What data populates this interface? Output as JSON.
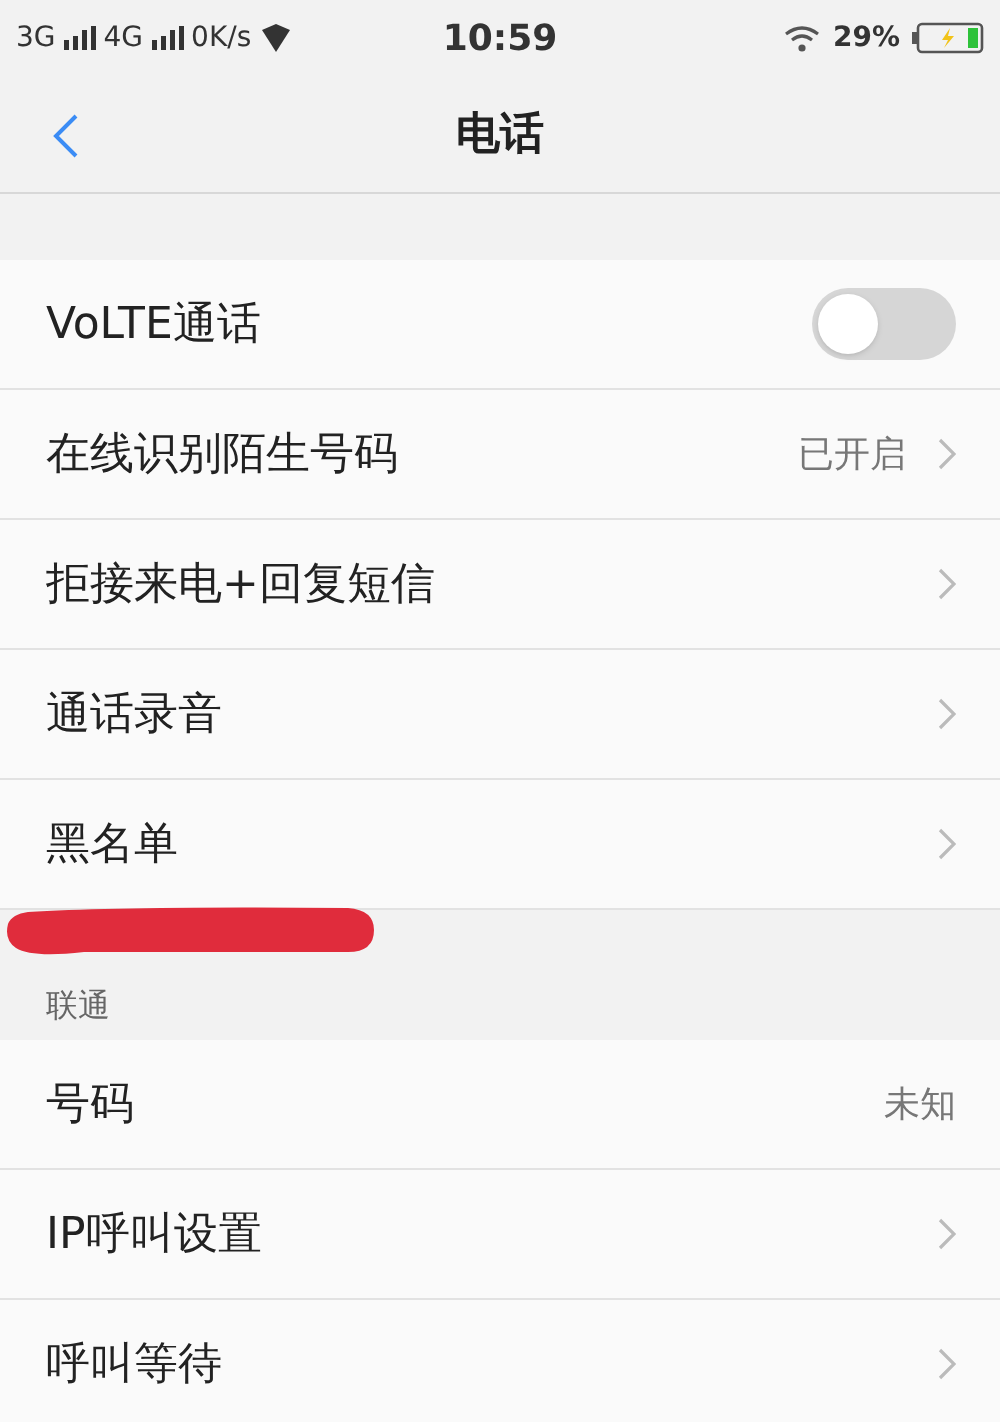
{
  "status_bar": {
    "left": [
      "3G",
      "4G",
      "0K/s"
    ],
    "time": "10:59",
    "battery_text": "29%",
    "charging": true
  },
  "header": {
    "title": "电话"
  },
  "sections": [
    {
      "rows": [
        {
          "kind": "toggle",
          "label": "VoLTE通话",
          "on": false
        },
        {
          "kind": "link",
          "label": "在线识别陌生号码",
          "value": "已开启"
        },
        {
          "kind": "link",
          "label": "拒接来电+回复短信"
        },
        {
          "kind": "link",
          "label": "通话录音"
        },
        {
          "kind": "link",
          "label": "黑名单"
        }
      ]
    },
    {
      "title": "联通",
      "rows": [
        {
          "kind": "value",
          "label": "号码",
          "value": "未知"
        },
        {
          "kind": "link",
          "label": "IP呼叫设置"
        },
        {
          "kind": "link",
          "label": "呼叫等待"
        }
      ]
    }
  ]
}
